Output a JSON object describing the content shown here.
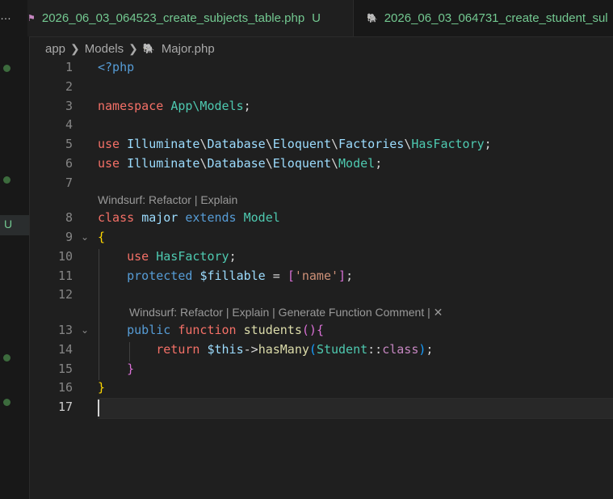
{
  "tabs": [
    {
      "label": "2026_06_03_064523_create_subjects_table.php",
      "status": "U",
      "icon": "migration-icon",
      "active": true
    },
    {
      "label": "2026_06_03_064731_create_student_sul",
      "status": "",
      "icon": "php-elephant-icon",
      "active": false
    }
  ],
  "overflow_label": "…",
  "breadcrumb": [
    "app",
    "Models",
    "Major.php"
  ],
  "gutter_status_letter": "U",
  "codelens": {
    "class": "Windsurf: Refactor | Explain",
    "method": "Windsurf: Refactor | Explain | Generate Function Comment | ✕"
  },
  "line_numbers": [
    "1",
    "2",
    "3",
    "4",
    "5",
    "6",
    "7",
    "8",
    "9",
    "10",
    "11",
    "12",
    "13",
    "14",
    "15",
    "16",
    "17"
  ],
  "code": {
    "l1": "<?php",
    "l3_kw": "namespace",
    "l3_ns": "App\\Models",
    "l3_end": ";",
    "l5_kw": "use",
    "l5_p1": "Illuminate",
    "l5_p2": "Database",
    "l5_p3": "Eloquent",
    "l5_p4": "Factories",
    "l5_cls": "HasFactory",
    "l5_end": ";",
    "l6_kw": "use",
    "l6_p1": "Illuminate",
    "l6_p2": "Database",
    "l6_p3": "Eloquent",
    "l6_cls": "Model",
    "l6_end": ";",
    "l8_kw": "class",
    "l8_name": "major",
    "l8_ext": "extends",
    "l8_parent": "Model",
    "l9": "{",
    "l10_kw": "use",
    "l10_cls": "HasFactory",
    "l10_end": ";",
    "l11_kw": "protected",
    "l11_var": "$fillable",
    "l11_eq": " = ",
    "l11_open": "[",
    "l11_str": "'name'",
    "l11_close": "]",
    "l11_end": ";",
    "l13_kw": "public",
    "l13_fn": "function",
    "l13_name": "students",
    "l13_paren": "()",
    "l13_brace": "{",
    "l14_kw": "return",
    "l14_this": "$this",
    "l14_arrow": "->",
    "l14_call": "hasMany",
    "l14_open": "(",
    "l14_cls": "Student",
    "l14_sep": "::",
    "l14_kw2": "class",
    "l14_close": ")",
    "l14_end": ";",
    "l15": "}",
    "l16": "}"
  },
  "colors": {
    "background": "#1f1f1f",
    "git_untracked": "#73c991",
    "keyword": "#f47067",
    "namespace": "#4fc1ff",
    "type": "#4ec9b0",
    "string": "#ce9178"
  }
}
